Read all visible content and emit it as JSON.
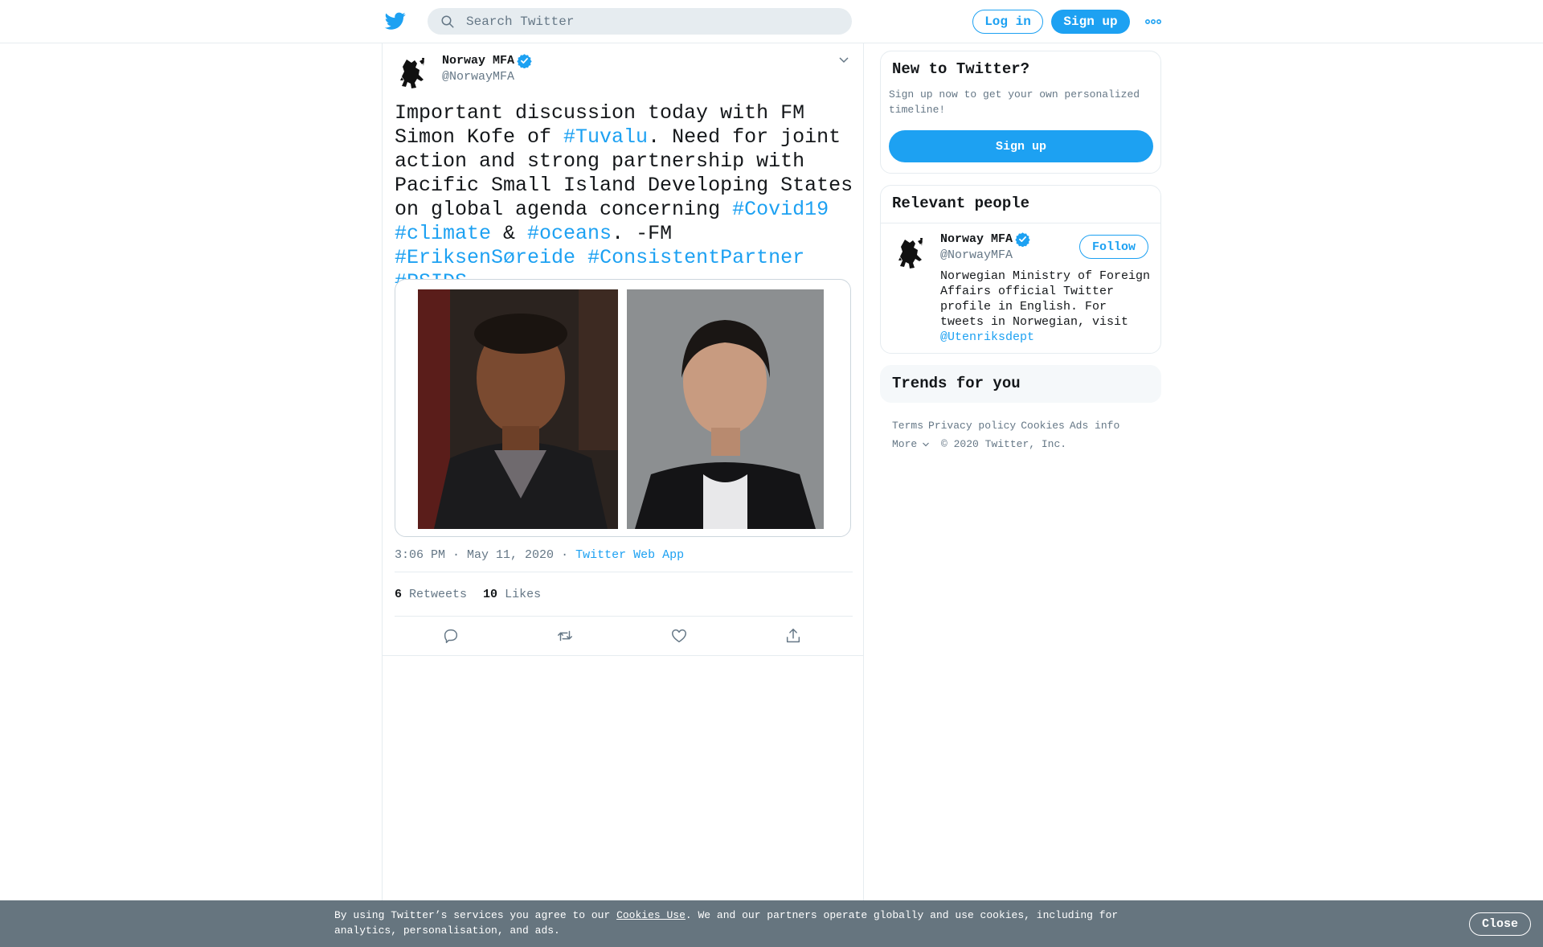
{
  "topbar": {
    "search_placeholder": "Search Twitter",
    "login_label": "Log in",
    "signup_label": "Sign up",
    "icons": [
      "twitter-logo-icon",
      "search-icon",
      "more-icon"
    ]
  },
  "tweet": {
    "author_name": "Norway MFA",
    "author_handle": "@NorwayMFA",
    "text_segments": [
      {
        "t": "Important discussion today with FM Simon Kofe of ",
        "tag": false
      },
      {
        "t": "#Tuvalu",
        "tag": true
      },
      {
        "t": ". Need for joint action and strong partnership with Pacific Small Island Developing States on global agenda concerning ",
        "tag": false
      },
      {
        "t": "#Covid19",
        "tag": true
      },
      {
        "t": " ",
        "tag": false
      },
      {
        "t": "#climate",
        "tag": true
      },
      {
        "t": " & ",
        "tag": false
      },
      {
        "t": "#oceans",
        "tag": true
      },
      {
        "t": ". -FM ",
        "tag": false
      },
      {
        "t": "#EriksenSøreide",
        "tag": true
      },
      {
        "t": " ",
        "tag": false
      },
      {
        "t": "#ConsistentPartner",
        "tag": true
      },
      {
        "t": " ",
        "tag": false
      },
      {
        "t": "#PSIDS",
        "tag": true
      }
    ],
    "timestamp": "3:06 PM · May 11, 2020",
    "source_sep": "·",
    "source": "Twitter Web App",
    "retweets_count": "6",
    "retweets_label": "Retweets",
    "likes_count": "10",
    "likes_label": "Likes"
  },
  "sidebar": {
    "new_title": "New to Twitter?",
    "new_desc": "Sign up now to get your own personalized timeline!",
    "new_signup": "Sign up",
    "people_title": "Relevant people",
    "person": {
      "name": "Norway MFA",
      "handle": "@NorwayMFA",
      "follow_label": "Follow",
      "bio": "Norwegian Ministry of Foreign Affairs official Twitter profile in English. For tweets in Norwegian, visit ",
      "bio_mention": "@Utenriksdept"
    },
    "trends_title": "Trends for you",
    "footer": {
      "terms": "Terms",
      "privacy": "Privacy policy",
      "cookies": "Cookies",
      "ads": "Ads info",
      "more": "More",
      "copyright": "© 2020 Twitter, Inc."
    }
  },
  "cookie_banner": {
    "text_before": "By using Twitter’s services you agree to our ",
    "link": "Cookies Use",
    "text_after": ". We and our partners operate globally and use cookies, including for analytics, personalisation, and ads.",
    "close_label": "Close"
  },
  "colors": {
    "accent": "#1da1f2",
    "text": "#14171a",
    "secondary": "#657786",
    "border": "#e6ecf0",
    "banner": "#66757f"
  }
}
